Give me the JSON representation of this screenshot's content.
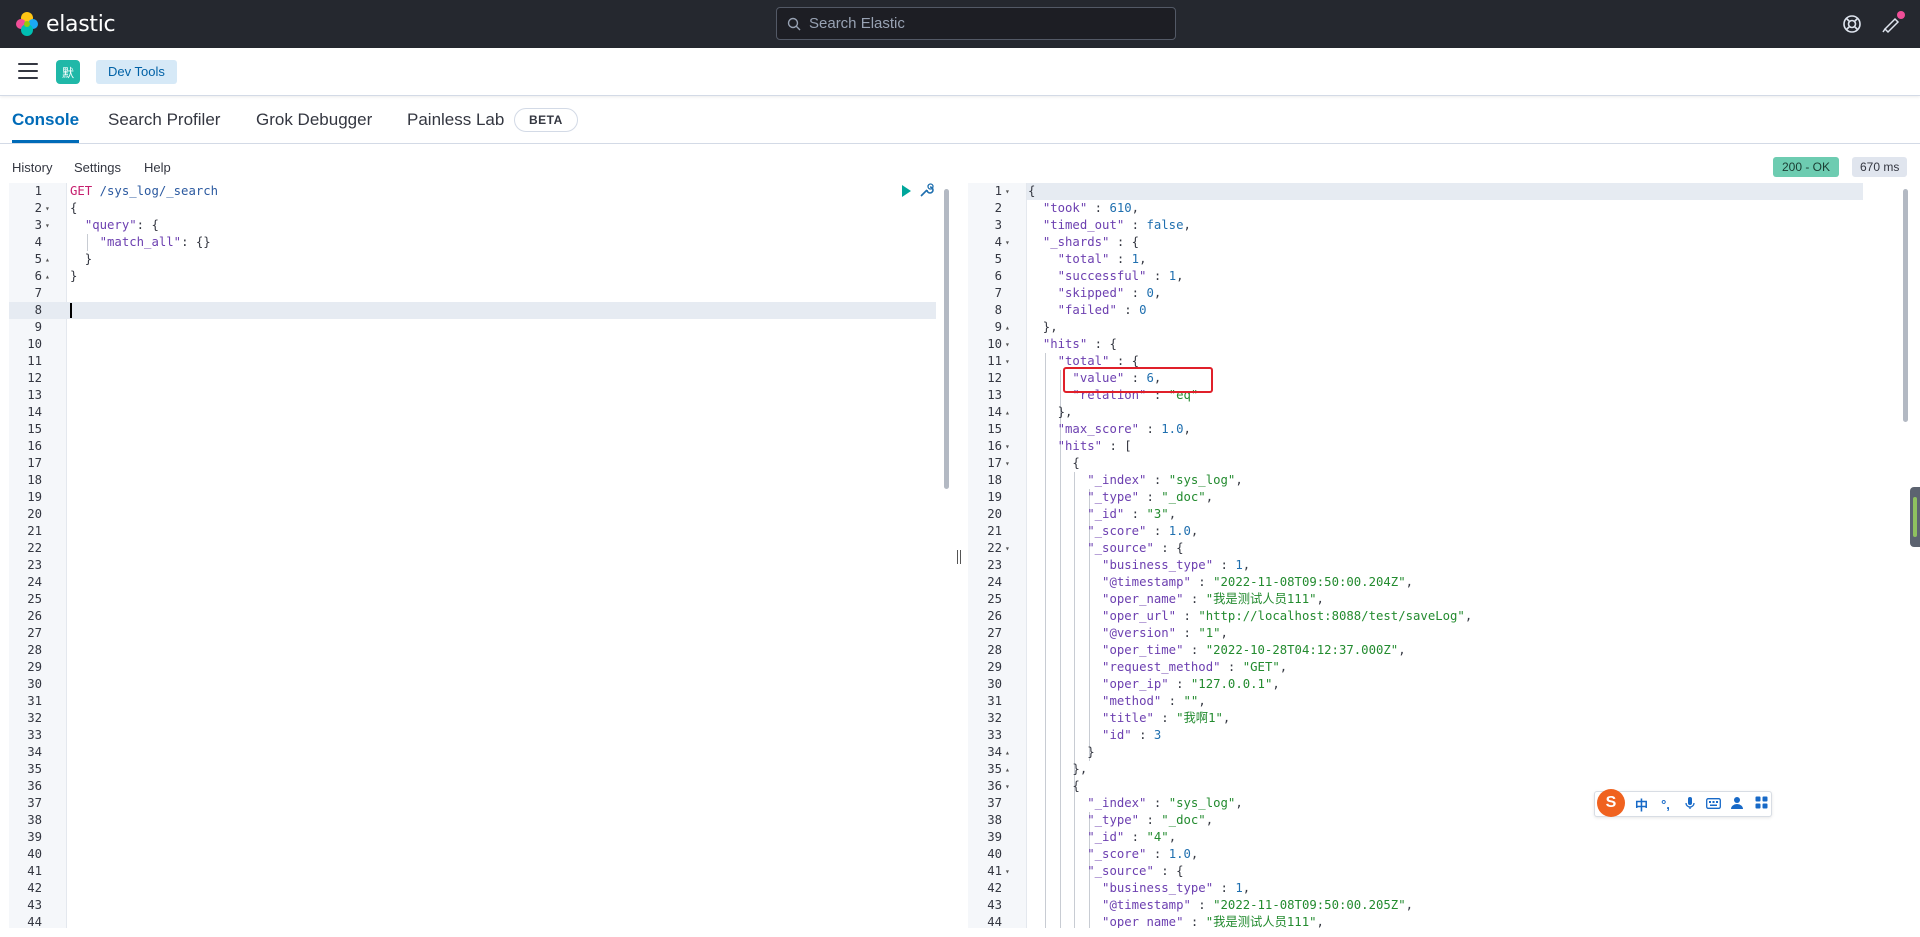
{
  "header": {
    "logo_text": "elastic",
    "search_placeholder": "Search Elastic"
  },
  "navbar": {
    "space_initial": "默",
    "breadcrumb": "Dev Tools"
  },
  "tabs": [
    {
      "label": "Console",
      "active": true
    },
    {
      "label": "Search Profiler",
      "active": false
    },
    {
      "label": "Grok Debugger",
      "active": false
    },
    {
      "label": "Painless Lab",
      "active": false
    }
  ],
  "beta_badge": "BETA",
  "toolbar": {
    "history": "History",
    "settings": "Settings",
    "help": "Help"
  },
  "response_status": "200 - OK",
  "response_time": "670 ms",
  "request_editor": {
    "line_count": 44,
    "active_line": 8,
    "lines": [
      "GET /sys_log/_search",
      "{",
      "  \"query\": {",
      "    \"match_all\": {}",
      "  }",
      "}",
      "",
      "",
      "",
      "",
      "",
      "",
      "",
      "",
      "",
      "",
      "",
      "",
      "",
      "",
      "",
      "",
      "",
      "",
      "",
      "",
      "",
      "",
      "",
      "",
      "",
      "",
      "",
      "",
      "",
      "",
      "",
      "",
      "",
      "",
      "",
      "",
      "",
      ""
    ]
  },
  "response_editor": {
    "lines": [
      "{",
      "  \"took\" : 610,",
      "  \"timed_out\" : false,",
      "  \"_shards\" : {",
      "    \"total\" : 1,",
      "    \"successful\" : 1,",
      "    \"skipped\" : 0,",
      "    \"failed\" : 0",
      "  },",
      "  \"hits\" : {",
      "    \"total\" : {",
      "      \"value\" : 6,",
      "      \"relation\" : \"eq\"",
      "    },",
      "    \"max_score\" : 1.0,",
      "    \"hits\" : [",
      "      {",
      "        \"_index\" : \"sys_log\",",
      "        \"_type\" : \"_doc\",",
      "        \"_id\" : \"3\",",
      "        \"_score\" : 1.0,",
      "        \"_source\" : {",
      "          \"business_type\" : 1,",
      "          \"@timestamp\" : \"2022-11-08T09:50:00.204Z\",",
      "          \"oper_name\" : \"我是测试人员111\",",
      "          \"oper_url\" : \"http://localhost:8088/test/saveLog\",",
      "          \"@version\" : \"1\",",
      "          \"oper_time\" : \"2022-10-28T04:12:37.000Z\",",
      "          \"request_method\" : \"GET\",",
      "          \"oper_ip\" : \"127.0.0.1\",",
      "          \"method\" : \"\",",
      "          \"title\" : \"我啊1\",",
      "          \"id\" : 3",
      "        }",
      "      },",
      "      {",
      "        \"_index\" : \"sys_log\",",
      "        \"_type\" : \"_doc\",",
      "        \"_id\" : \"4\",",
      "        \"_score\" : 1.0,",
      "        \"_source\" : {",
      "          \"business_type\" : 1,",
      "          \"@timestamp\" : \"2022-11-08T09:50:00.205Z\",",
      "          \"oper_name\" : \"我是测试人员111\","
    ],
    "fold_lines": [
      1,
      4,
      9,
      10,
      11,
      14,
      16,
      17,
      22,
      34,
      35,
      36,
      41
    ]
  },
  "request_fold_lines": [
    2,
    3,
    5,
    6
  ],
  "ime": {
    "logo": "S",
    "buttons": [
      "中",
      "°,",
      "🎤",
      "⌨",
      "👤",
      "▦"
    ]
  }
}
